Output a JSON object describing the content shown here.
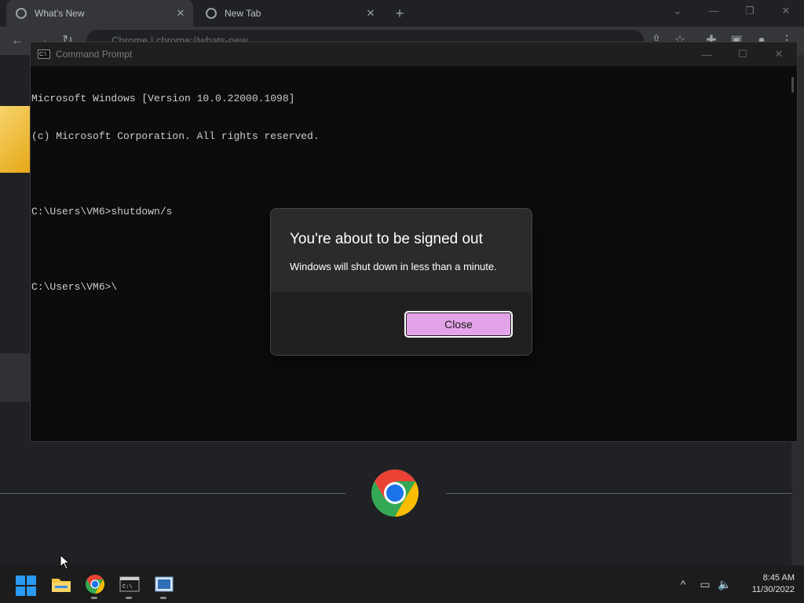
{
  "browser": {
    "tabs": [
      {
        "label": "What's New",
        "active": true
      },
      {
        "label": "New Tab",
        "active": false
      }
    ],
    "address": "Chrome  |  chrome://whats-new"
  },
  "cmd": {
    "title": "Command Prompt",
    "lines": [
      "Microsoft Windows [Version 10.0.22000.1098]",
      "(c) Microsoft Corporation. All rights reserved.",
      "",
      "C:\\Users\\VM6>shutdown/s",
      "",
      "C:\\Users\\VM6>\\"
    ]
  },
  "dialog": {
    "title": "You're about to be signed out",
    "message": "Windows will shut down in less than a minute.",
    "close_label": "Close",
    "button_color": "#e3a3e8"
  },
  "taskbar": {
    "apps": [
      "start-icon",
      "file-explorer-icon",
      "chrome-icon",
      "command-prompt-icon",
      "app-icon"
    ],
    "time": "8:45 AM",
    "date": "11/30/2022"
  }
}
